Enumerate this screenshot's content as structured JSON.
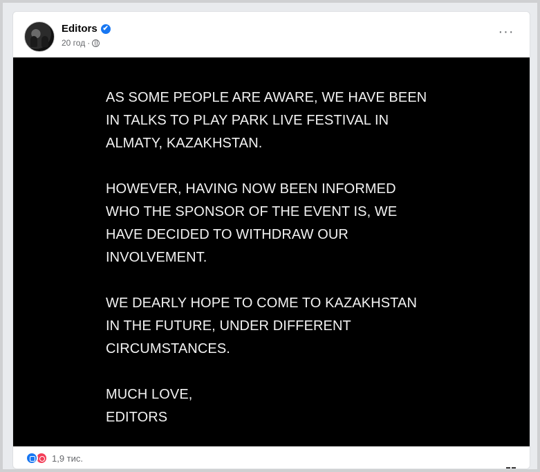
{
  "post": {
    "author": "Editors",
    "timestamp": "20 год",
    "more_label": "···",
    "verified": "✔",
    "statement_paragraphs": [
      [
        "AS SOME PEOPLE ARE AWARE, WE HAVE BEEN",
        "IN TALKS TO PLAY PARK LIVE FESTIVAL IN",
        "ALMATY, KAZAKHSTAN."
      ],
      [
        "HOWEVER, HAVING NOW BEEN INFORMED",
        "WHO THE SPONSOR OF THE EVENT IS, WE",
        "HAVE DECIDED TO WITHDRAW OUR",
        "INVOLVEMENT."
      ],
      [
        "WE DEARLY HOPE TO COME TO KAZAKHSTAN",
        "IN THE FUTURE, UNDER DIFFERENT",
        "CIRCUMSTANCES."
      ],
      [
        "MUCH LOVE,",
        "EDITORS"
      ]
    ]
  },
  "reactions": {
    "icons": [
      "like-icon",
      "love-icon"
    ],
    "count": "1,9 тис."
  },
  "colors": {
    "image_background": "#000000",
    "statement_text": "#f2f2f2",
    "like": "#1877f2",
    "love": "#f33e58",
    "verified": "#1877f2"
  }
}
